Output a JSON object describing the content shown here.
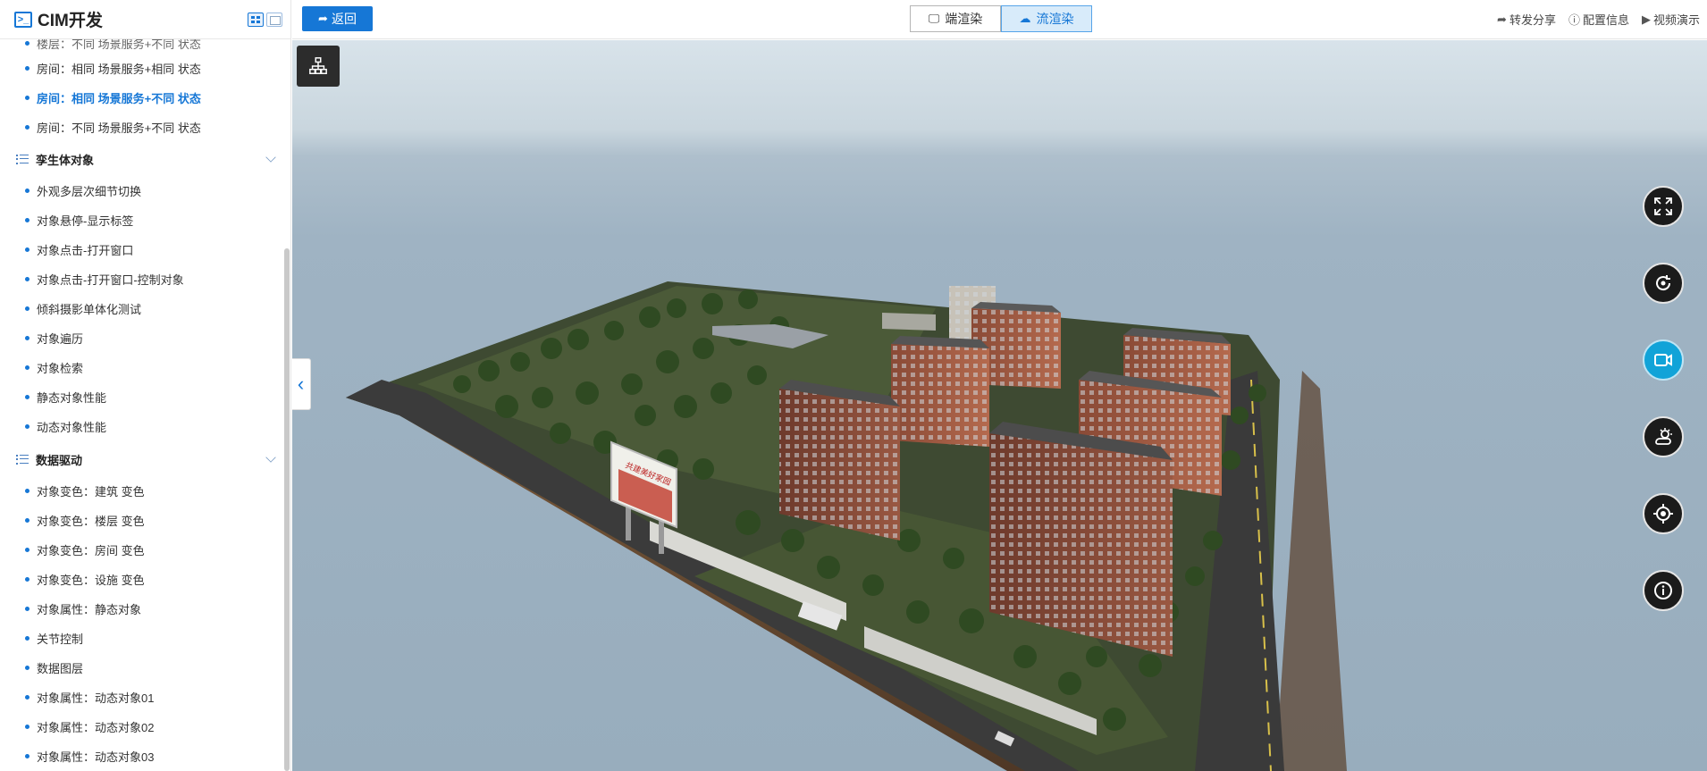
{
  "sidebar": {
    "app_title": "CIM开发",
    "app_logo": ">_",
    "cut_item": "楼层：不同 场景服务+不同 状态",
    "top_items": [
      {
        "label": "房间：相同 场景服务+相同 状态"
      },
      {
        "label": "房间：相同 场景服务+不同 状态",
        "active": true
      },
      {
        "label": "房间：不同 场景服务+不同 状态"
      }
    ],
    "sections": [
      {
        "title": "孪生体对象",
        "items": [
          {
            "label": "外观多层次细节切换"
          },
          {
            "label": "对象悬停-显示标签"
          },
          {
            "label": "对象点击-打开窗口"
          },
          {
            "label": "对象点击-打开窗口-控制对象"
          },
          {
            "label": "倾斜摄影单体化测试"
          },
          {
            "label": "对象遍历"
          },
          {
            "label": "对象检索"
          },
          {
            "label": "静态对象性能"
          },
          {
            "label": "动态对象性能"
          }
        ]
      },
      {
        "title": "数据驱动",
        "items": [
          {
            "label": "对象变色：建筑 变色"
          },
          {
            "label": "对象变色：楼层 变色"
          },
          {
            "label": "对象变色：房间 变色"
          },
          {
            "label": "对象变色：设施 变色"
          },
          {
            "label": "对象属性：静态对象"
          },
          {
            "label": "关节控制"
          },
          {
            "label": "数据图层"
          },
          {
            "label": "对象属性：动态对象01"
          },
          {
            "label": "对象属性：动态对象02"
          },
          {
            "label": "对象属性：动态对象03"
          }
        ]
      }
    ]
  },
  "toolbar": {
    "back_label": "返回",
    "render_modes": [
      {
        "label": "端渲染",
        "icon": "monitor-icon",
        "selected": false
      },
      {
        "label": "流渲染",
        "icon": "cloud-download-icon",
        "selected": true
      }
    ],
    "links": [
      {
        "label": "转发分享",
        "icon": "share-arrow-icon"
      },
      {
        "label": "配置信息",
        "icon": "info-circle-icon"
      },
      {
        "label": "视频演示",
        "icon": "play-circle-icon"
      }
    ]
  },
  "viewport": {
    "billboard_text": "共建美好家园",
    "controls": [
      {
        "name": "fullscreen-icon"
      },
      {
        "name": "rotate-icon"
      },
      {
        "name": "camera-icon",
        "active": true
      },
      {
        "name": "weather-icon"
      },
      {
        "name": "locate-icon"
      },
      {
        "name": "info-icon"
      }
    ],
    "accent": "#1677d6"
  }
}
